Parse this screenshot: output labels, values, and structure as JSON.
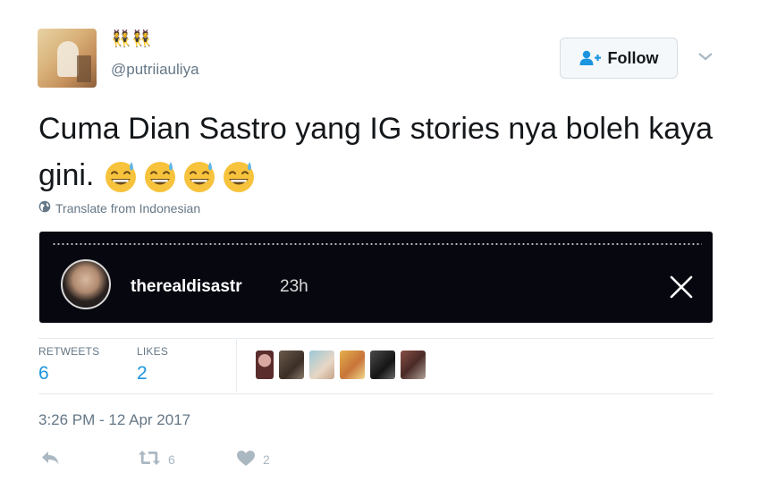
{
  "header": {
    "display_name_emoji": "👯👯",
    "handle": "@putriiauliya",
    "follow_label": "Follow"
  },
  "tweet": {
    "text": "Cuma Dian Sastro yang IG stories nya boleh kaya gini.",
    "emoji_count": 4,
    "emoji_icon": "grinning-face-with-sweat-icon",
    "translate_label": "Translate from Indonesian"
  },
  "story": {
    "username": "therealdisastr",
    "age": "23h"
  },
  "stats": {
    "retweets_label": "RETWEETS",
    "retweets_value": "6",
    "likes_label": "LIKES",
    "likes_value": "2"
  },
  "timestamp": "3:26 PM - 12 Apr 2017",
  "actions": {
    "reply_icon": "reply-icon",
    "retweet_icon": "retweet-icon",
    "retweet_count": "6",
    "like_icon": "heart-icon",
    "like_count": "2"
  },
  "colors": {
    "accent": "#1b95e0",
    "muted": "#657786",
    "story_bg": "#070710",
    "action": "#aab8c2"
  }
}
